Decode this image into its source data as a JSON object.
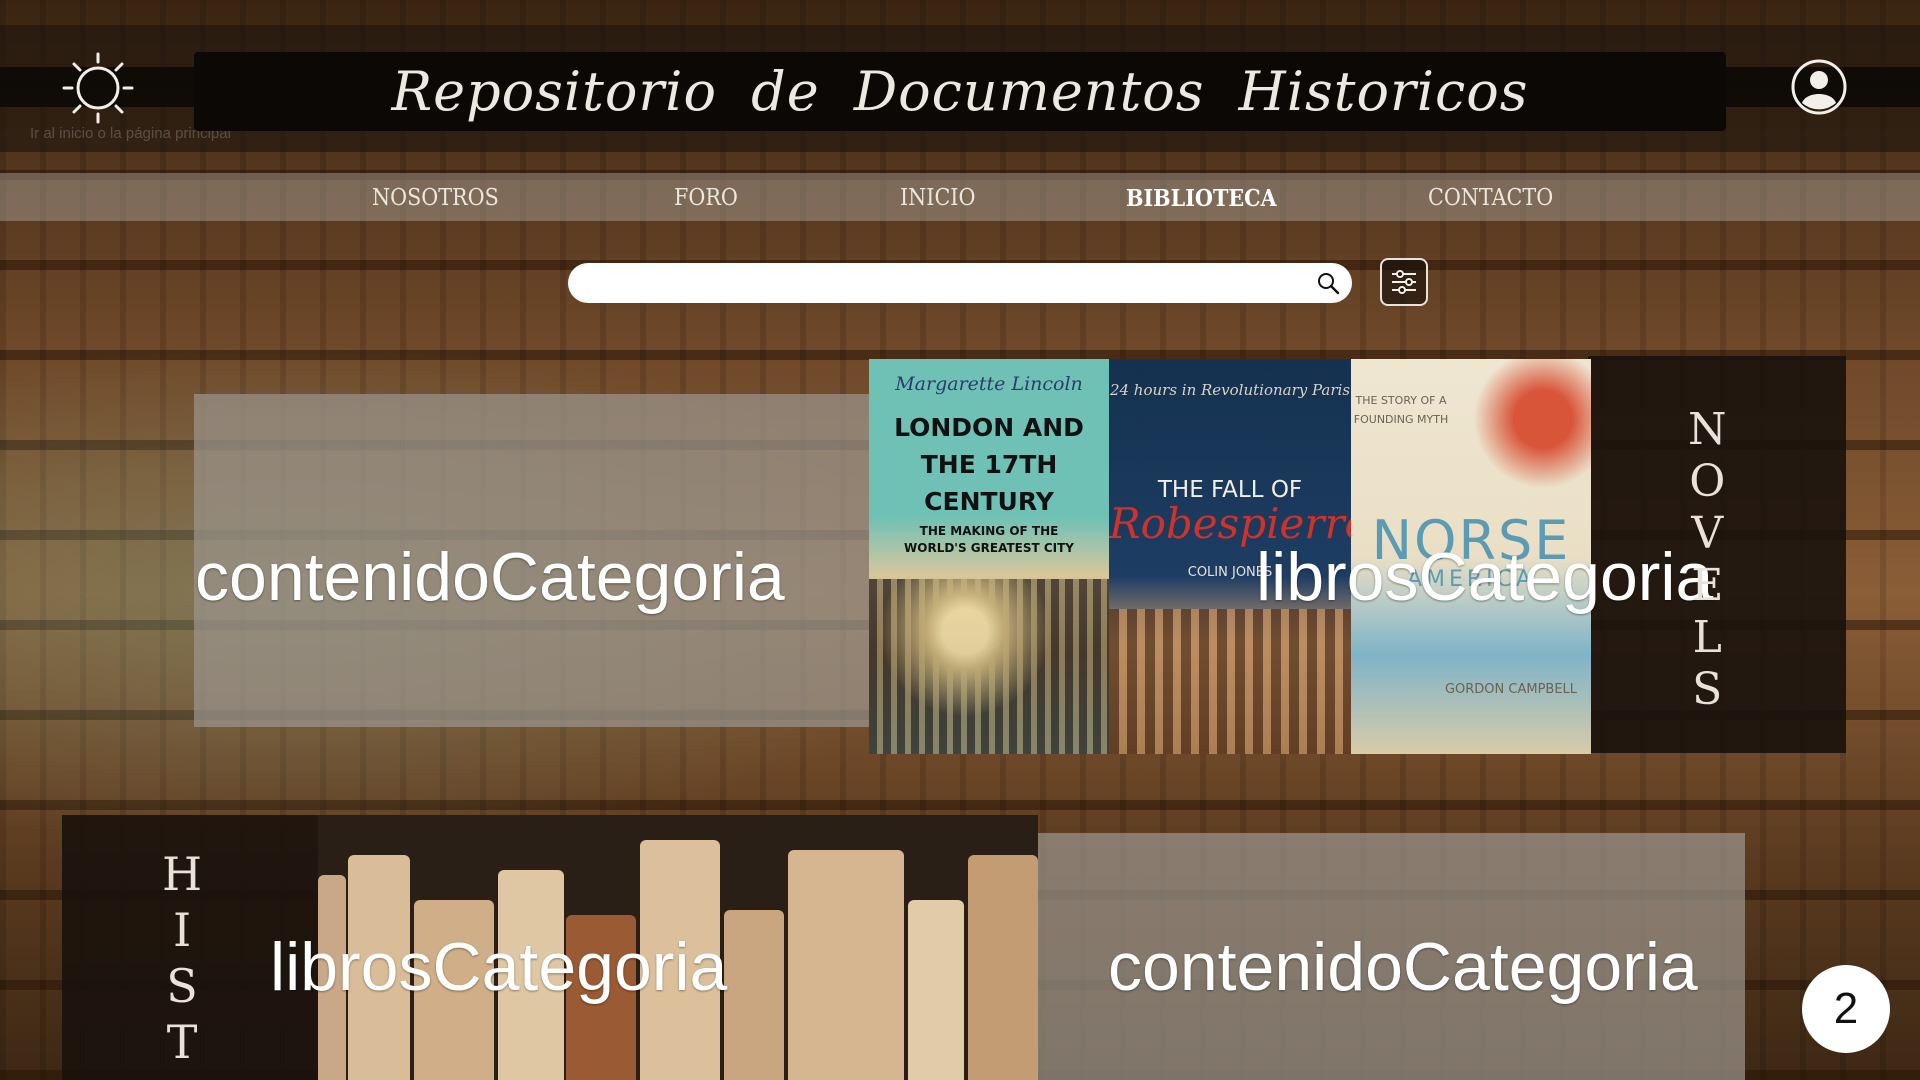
{
  "header": {
    "title": "Repositorio de Documentos Historicos",
    "logo_alt": "Ir al inicio o la página principal",
    "logo_icon": "sun-moon-icon",
    "user_icon": "user-circle-icon"
  },
  "nav": {
    "items": [
      {
        "label": "NOSOTROS"
      },
      {
        "label": "FORO"
      },
      {
        "label": "INICIO"
      },
      {
        "label": "BIBLIOTECA"
      },
      {
        "label": "CONTACTO"
      }
    ],
    "active": "BIBLIOTECA"
  },
  "search": {
    "value": "",
    "placeholder": "",
    "icon": "search-icon",
    "filter_icon": "sliders-icon"
  },
  "sections": [
    {
      "vertical_label": [
        "N",
        "O",
        "V",
        "E",
        "L",
        "S"
      ],
      "contenido_label": "contenidoCategoria",
      "libros_label": "librosCategoria",
      "covers": [
        {
          "author": "Margarette Lincoln",
          "title": "LONDON AND THE 17TH CENTURY",
          "subtitle": "THE MAKING OF THE WORLD'S GREATEST CITY"
        },
        {
          "tagline": "24 hours in Revolutionary Paris",
          "title": "THE FALL OF",
          "title2": "Robespierre",
          "author": "COLIN JONES"
        },
        {
          "tagline": "THE STORY OF A FOUNDING MYTH",
          "title": "NORSE",
          "title2": "AMERICA",
          "author": "GORDON CAMPBELL"
        }
      ]
    },
    {
      "vertical_label": [
        "H",
        "I",
        "S",
        "T"
      ],
      "libros_label": "librosCategoria",
      "contenido_label": "contenidoCategoria"
    }
  ],
  "pagination": {
    "current": "2"
  },
  "colors": {
    "title_bar": "#0c0806",
    "nav_bg": "#afa8a0",
    "panel_light": "#9b948c",
    "panel_dark": "#19120c"
  }
}
